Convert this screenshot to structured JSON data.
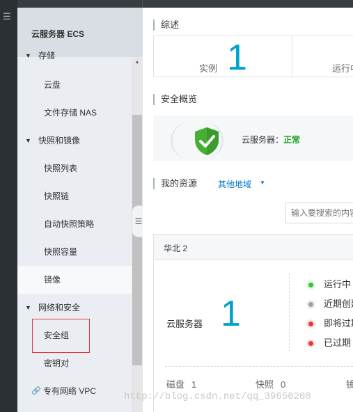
{
  "sidebar": {
    "title": "云服务器 ECS",
    "storage_group": "存储",
    "disk": "云盘",
    "nas": "文件存储 NAS",
    "snapshot_group": "快照和镜像",
    "snapshot_list": "快照列表",
    "snapshot_chain": "快照链",
    "auto_snapshot_policy": "自动快照策略",
    "snapshot_capacity": "快照容量",
    "image": "镜像",
    "network_group": "网络和安全",
    "security_group": "安全组",
    "key_pair": "密钥对",
    "vpc": "专有网络 VPC"
  },
  "main": {
    "overview_title": "综述",
    "instance_label": "实例",
    "instance_count": "1",
    "running_label": "运行中",
    "security_title": "安全概览",
    "security_label": "云服务器：",
    "security_status": "正常",
    "resources_title": "我的资源",
    "other_regions": "其他地域",
    "search_placeholder": "输入要搜索的内容",
    "region_name": "华北 2",
    "ecs_label": "云服务器",
    "ecs_count": "1",
    "status_running": "运行中",
    "status_recent": "近期创建",
    "status_expiring": "即将过期",
    "status_expired": "已过期",
    "disk_label": "磁盘",
    "disk_count": "1",
    "snapshot_label": "快照",
    "snapshot_count": "0",
    "image_label": "镜像"
  },
  "colors": {
    "accent": "#00a2ca",
    "link": "#0077c6",
    "ok": "#1aa31e",
    "running_dot": "#31c72c",
    "recent_dot": "#9e9e9e",
    "warning_dot": "#e4393c",
    "highlight_border": "#e4393c"
  },
  "icons": [
    "menu-icon",
    "scroll-up-icon",
    "collapse-sidebar-icon",
    "shield-check-icon",
    "link-icon",
    "caret-down-icon"
  ],
  "watermark": "http://blog.csdn.net/qq_39650208"
}
